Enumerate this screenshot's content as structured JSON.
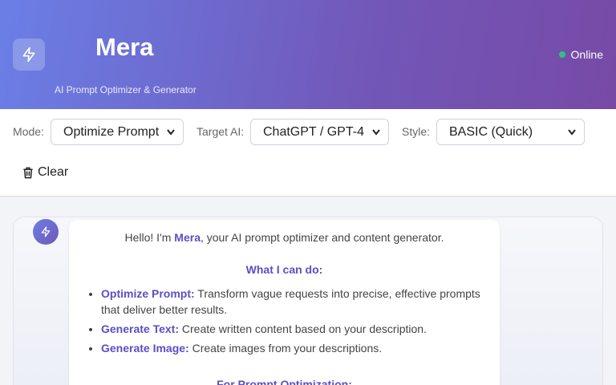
{
  "header": {
    "title": "Mera",
    "subtitle": "AI Prompt Optimizer & Generator",
    "status": "Online",
    "logo_icon": "lightning-bolt-icon"
  },
  "toolbar": {
    "mode_label": "Mode:",
    "mode_value": "Optimize Prompt",
    "target_label": "Target AI:",
    "target_value": "ChatGPT / GPT-4",
    "style_label": "Style:",
    "style_value": "BASIC (Quick)",
    "clear_label": "Clear"
  },
  "message": {
    "greet_prefix": "Hello! I'm ",
    "greet_name": "Mera",
    "greet_suffix": ", your AI prompt optimizer and content generator.",
    "capabilities_heading": "What I can do:",
    "capabilities": [
      {
        "name": "Optimize Prompt:",
        "desc": " Transform vague requests into precise, effective prompts that deliver better results."
      },
      {
        "name": "Generate Text:",
        "desc": " Create written content based on your description."
      },
      {
        "name": "Generate Image:",
        "desc": " Create images from your descriptions."
      }
    ],
    "next_heading": "For Prompt Optimization:"
  },
  "colors": {
    "accent": "#5b4fc4",
    "online": "#2ec27e"
  }
}
